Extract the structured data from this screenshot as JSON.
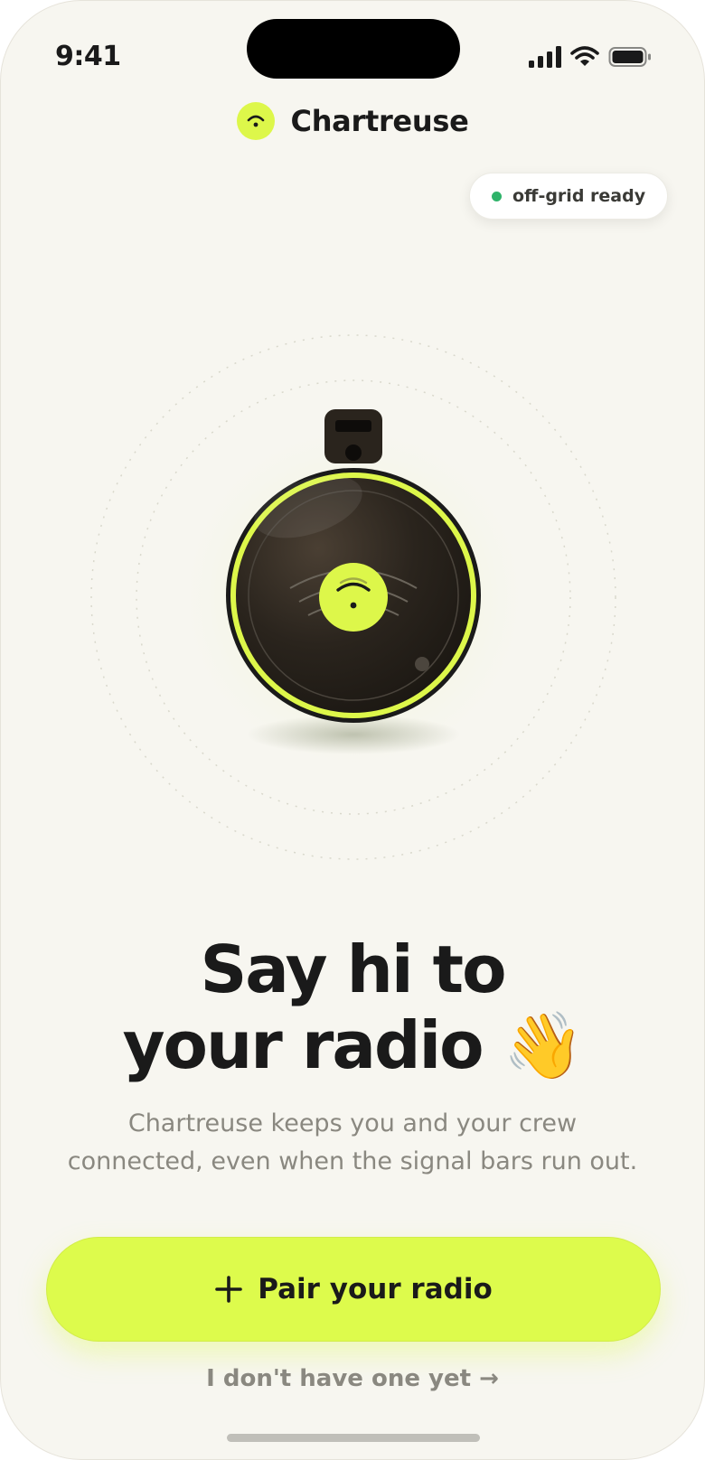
{
  "status_bar": {
    "time": "9:41",
    "icons": [
      "cellular-signal-icon",
      "wifi-icon",
      "battery-icon"
    ]
  },
  "brand": {
    "name": "Chartreuse",
    "logo_icon": "signal-waves-icon"
  },
  "status_pill": {
    "label": "off-grid ready",
    "dot_color": "#2fb36a"
  },
  "hero": {
    "illustration": "radio-device-illustration",
    "accent_color": "#ddf74a"
  },
  "headline": {
    "line1": "Say hi to",
    "line2": "your radio",
    "emoji": "👋"
  },
  "subtitle": {
    "line1": "Chartreuse keeps you and your crew",
    "line2": "connected, even when the signal bars run out."
  },
  "primary_button": {
    "icon": "plus-icon",
    "label": "Pair your radio",
    "color": "#ddfb4c"
  },
  "secondary_link": {
    "label": "I don't have one yet →"
  }
}
